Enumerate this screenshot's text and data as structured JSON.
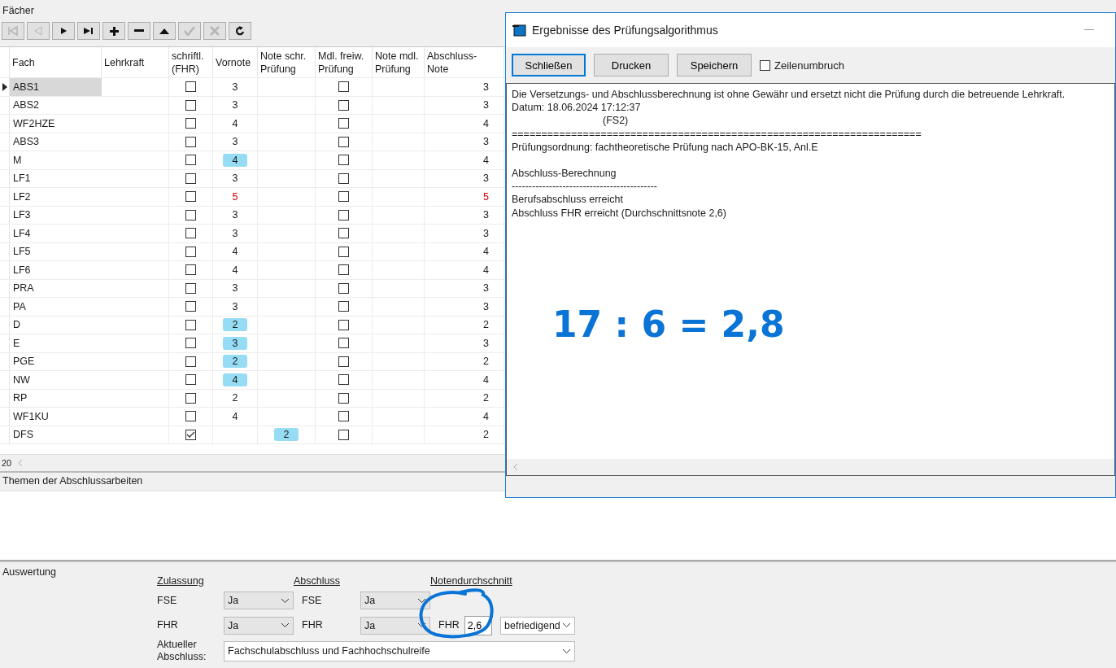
{
  "faecher": {
    "title": "Fächer",
    "toolbar": [
      {
        "kind": "first",
        "disabled": true
      },
      {
        "kind": "prev",
        "disabled": true
      },
      {
        "kind": "next",
        "disabled": false
      },
      {
        "kind": "last",
        "disabled": false
      },
      {
        "kind": "add",
        "disabled": false
      },
      {
        "kind": "remove",
        "disabled": false
      },
      {
        "kind": "up",
        "disabled": false
      },
      {
        "kind": "confirm",
        "disabled": true
      },
      {
        "kind": "cancel",
        "disabled": true
      },
      {
        "kind": "refresh",
        "disabled": false
      }
    ],
    "columns": [
      "Fach",
      "Lehrkraft",
      "schriftl.\n(FHR)",
      "Vornote",
      "Note schr.\nPrüfung",
      "Mdl. freiw.\nPrüfung",
      "Note mdl.\nPrüfung",
      "Abschluss-\nNote"
    ],
    "rows": [
      {
        "fach": "ABS1",
        "selected": true,
        "schriftlich": false,
        "vornote": "3",
        "mdl_freiw": false,
        "abschluss": "3",
        "failing": false
      },
      {
        "fach": "ABS2",
        "selected": false,
        "schriftlich": false,
        "vornote": "3",
        "mdl_freiw": false,
        "abschluss": "3",
        "failing": false
      },
      {
        "fach": "WF2HZE",
        "selected": false,
        "schriftlich": false,
        "vornote": "4",
        "mdl_freiw": false,
        "abschluss": "4",
        "failing": false
      },
      {
        "fach": "ABS3",
        "selected": false,
        "schriftlich": false,
        "vornote": "3",
        "mdl_freiw": false,
        "abschluss": "3",
        "failing": false
      },
      {
        "fach": "M",
        "selected": false,
        "schriftlich": false,
        "vornote": "4",
        "vornote_marked": true,
        "mdl_freiw": false,
        "abschluss": "4",
        "failing": false
      },
      {
        "fach": "LF1",
        "selected": false,
        "schriftlich": false,
        "vornote": "3",
        "mdl_freiw": false,
        "abschluss": "3",
        "failing": false
      },
      {
        "fach": "LF2",
        "selected": false,
        "schriftlich": false,
        "vornote": "5",
        "mdl_freiw": false,
        "abschluss": "5",
        "failing": true
      },
      {
        "fach": "LF3",
        "selected": false,
        "schriftlich": false,
        "vornote": "3",
        "mdl_freiw": false,
        "abschluss": "3",
        "failing": false
      },
      {
        "fach": "LF4",
        "selected": false,
        "schriftlich": false,
        "vornote": "3",
        "mdl_freiw": false,
        "abschluss": "3",
        "failing": false
      },
      {
        "fach": "LF5",
        "selected": false,
        "schriftlich": false,
        "vornote": "4",
        "mdl_freiw": false,
        "abschluss": "4",
        "failing": false
      },
      {
        "fach": "LF6",
        "selected": false,
        "schriftlich": false,
        "vornote": "4",
        "mdl_freiw": false,
        "abschluss": "4",
        "failing": false
      },
      {
        "fach": "PRA",
        "selected": false,
        "schriftlich": false,
        "vornote": "3",
        "mdl_freiw": false,
        "abschluss": "3",
        "failing": false
      },
      {
        "fach": "PA",
        "selected": false,
        "schriftlich": false,
        "vornote": "3",
        "mdl_freiw": false,
        "abschluss": "3",
        "failing": false
      },
      {
        "fach": "D",
        "selected": false,
        "schriftlich": false,
        "vornote": "2",
        "vornote_marked": true,
        "mdl_freiw": false,
        "abschluss": "2",
        "failing": false
      },
      {
        "fach": "E",
        "selected": false,
        "schriftlich": false,
        "vornote": "3",
        "vornote_marked": true,
        "mdl_freiw": false,
        "abschluss": "3",
        "failing": false
      },
      {
        "fach": "PGE",
        "selected": false,
        "schriftlich": false,
        "vornote": "2",
        "vornote_marked": true,
        "mdl_freiw": false,
        "abschluss": "2",
        "failing": false
      },
      {
        "fach": "NW",
        "selected": false,
        "schriftlich": false,
        "vornote": "4",
        "vornote_marked": true,
        "mdl_freiw": false,
        "abschluss": "4",
        "failing": false
      },
      {
        "fach": "RP",
        "selected": false,
        "schriftlich": false,
        "vornote": "2",
        "mdl_freiw": false,
        "abschluss": "2",
        "failing": false
      },
      {
        "fach": "WF1KU",
        "selected": false,
        "schriftlich": false,
        "vornote": "4",
        "mdl_freiw": false,
        "abschluss": "4",
        "failing": false
      },
      {
        "fach": "DFS",
        "selected": false,
        "schriftlich": true,
        "note_schr": "2",
        "note_schr_marked": true,
        "mdl_freiw": false,
        "abschluss": "2",
        "failing": false
      }
    ],
    "record_count": "20"
  },
  "themen": {
    "title": "Themen der Abschlussarbeiten"
  },
  "dialog": {
    "title": "Ergebnisse des Prüfungsalgorithmus",
    "buttons": [
      {
        "label": "Schließen",
        "focused": true
      },
      {
        "label": "Drucken",
        "focused": false
      },
      {
        "label": "Speichern",
        "focused": false
      }
    ],
    "wrap_checkbox": {
      "label": "Zeilenumbruch",
      "checked": false
    },
    "blocks": [
      [
        "Die Versetzungs- und Abschlussberechnung ist ohne Gewähr und ersetzt nicht die Prüfung durch die betreuende Lehrkraft.",
        "Datum: 18.06.2024 17:12:37",
        "(FS2)",
        "=====================================================================",
        "Prüfungsordnung: fachtheoretische Prüfung nach APO-BK-15, Anl.E"
      ],
      [
        "Abschluss-Berechnung",
        "-------------------------------------------",
        "Berufsabschluss erreicht",
        "Abschluss FHR erreicht (Durchschnittsnote 2,6)"
      ]
    ],
    "handwritten_note": "17 : 6 = 2,8"
  },
  "auswertung": {
    "title": "Auswertung",
    "zulassung": {
      "heading": "Zulassung",
      "rows": [
        {
          "label": "FSE",
          "value": "Ja",
          "disabled": true
        },
        {
          "label": "FHR",
          "value": "Ja",
          "disabled": true
        }
      ]
    },
    "abschluss": {
      "heading": "Abschluss",
      "rows": [
        {
          "label": "FSE",
          "value": "Ja",
          "disabled": true
        },
        {
          "label": "FHR",
          "value": "Ja",
          "disabled": true
        }
      ]
    },
    "notendurchschnitt": {
      "heading": "Notendurchschnitt",
      "label": "FHR",
      "value": "2,6",
      "grade": "befriedigend"
    },
    "aktueller_abschluss": {
      "label": "Aktueller\nAbschluss:",
      "value": "Fachschulabschluss und Fachhochschulreife"
    }
  }
}
